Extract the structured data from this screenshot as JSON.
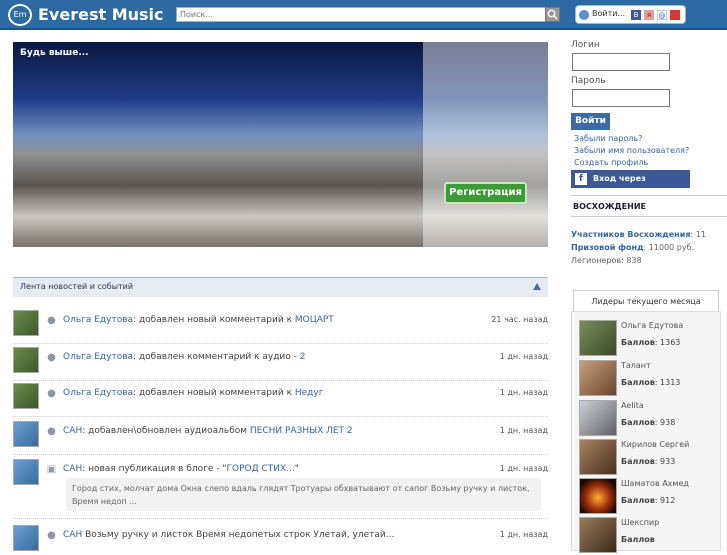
{
  "header": {
    "logo_text": "Em",
    "brand": "Everest Music",
    "search_placeholder": "Поиск...",
    "auth_label": "Войти..."
  },
  "hero": {
    "caption": "Будь выше...",
    "register_label": "Регистрация"
  },
  "news": {
    "title": "Лента новостей и событий",
    "items": [
      {
        "user": "Ольга Едутова",
        "text": ": добавлен новый комментарий к ",
        "link": "МОЦАРТ",
        "time": "21 час. назад"
      },
      {
        "user": "Ольга Едутова",
        "text": ": добавлен комментарий к аудио - ",
        "link": "2",
        "time": "1 дн. назад"
      },
      {
        "user": "Ольга Едутова",
        "text": ": добавлен новый комментарий к ",
        "link": "Недуг",
        "time": "1 дн. назад"
      },
      {
        "user": "САН",
        "text": ": добавлен\\обновлен аудиоальбом ",
        "link": "ПЕСНИ РАЗНЫХ ЛЕТ 2",
        "time": "1 дн. назад"
      },
      {
        "user": "САН",
        "text": ": новая публикация в блоге - \"",
        "link": "ГОРОД СТИХ...",
        "text_after": "\"",
        "time": "1 дн. назад",
        "quote": "Город стих, молчат дома Окна слепо вдаль глядят Тротуары обхватывают от сапог Возьму ручку и листок, Время недоп ..."
      },
      {
        "user": "САН",
        "text": " Возьму ручку и листок Время недопетых строк Улетай, улетай...",
        "link": "",
        "time": "1 дн. назад"
      }
    ]
  },
  "login": {
    "login_label": "Логин",
    "password_label": "Пароль",
    "submit": "Войти",
    "forgot_password": "Забыли пароль?",
    "forgot_username": "Забыли имя пользователя?",
    "create_profile": "Создать профиль",
    "facebook": "Вход через Facebook"
  },
  "ascent": {
    "title": "ВОСХОЖДЕНИЕ",
    "participants_label": "Участников Восхождения",
    "participants_value": ": 11",
    "prize_label": "Призовой фонд",
    "prize_value": ": 11000 руб.",
    "legion_label": "Легионеров",
    "legion_value": ": 838"
  },
  "leaders": {
    "tab": "Лидеры текущего месяца",
    "score_label": "Баллов",
    "items": [
      {
        "name": "Ольга Едутова",
        "score": ": 1363"
      },
      {
        "name": "Талант",
        "score": ": 1313"
      },
      {
        "name": "Aelita",
        "score": ": 938"
      },
      {
        "name": "Кирилов Сергей",
        "score": ": 933"
      },
      {
        "name": "Шаматов Ахмед",
        "score": ": 912"
      },
      {
        "name": "Шекспир",
        "score": ""
      }
    ]
  }
}
